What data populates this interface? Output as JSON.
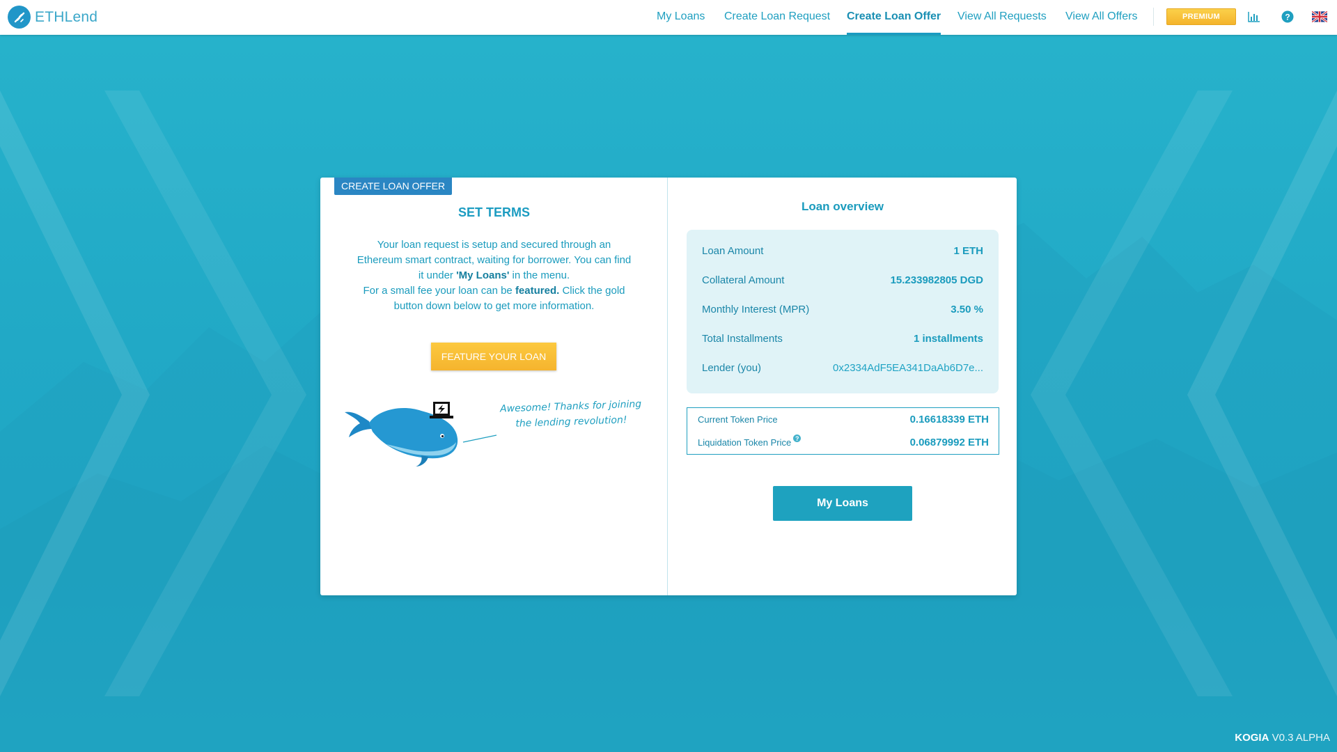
{
  "brand": {
    "name": "ETHLend"
  },
  "nav": {
    "items": [
      {
        "label": "My Loans"
      },
      {
        "label": "Create Loan Request"
      },
      {
        "label": "Create Loan Offer"
      },
      {
        "label": "View All Requests"
      },
      {
        "label": "View All Offers"
      }
    ],
    "active": "Create Loan Offer",
    "premium_label": "PREMIUM"
  },
  "icons": [
    "logo-icon",
    "stats-icon",
    "help-icon",
    "uk-flag-icon",
    "whale-illustration"
  ],
  "left": {
    "tag": "CREATE LOAN OFFER",
    "heading": "SET TERMS",
    "para1_a": "Your loan request is setup and secured through an Ethereum smart contract, waiting for borrower. You can find it under ",
    "para1_b": "'My Loans'",
    "para1_c": " in the menu.",
    "para2_a": "For a small fee your loan can be ",
    "para2_b": "featured.",
    "para2_c": " Click the gold button down below to get more information.",
    "feature_button": "FEATURE YOUR LOAN",
    "speech": "Awesome! Thanks for joining the lending revolution!"
  },
  "right": {
    "title": "Loan overview",
    "overview": [
      {
        "label": "Loan Amount",
        "value": "1 ETH"
      },
      {
        "label": "Collateral Amount",
        "value": "15.233982805 DGD"
      },
      {
        "label": "Monthly Interest (MPR)",
        "value": "3.50 %"
      },
      {
        "label": "Total Installments",
        "value": "1 installments"
      },
      {
        "label": "Lender (you)",
        "value": "0x2334AdF5EA341DaAb6D7e..."
      }
    ],
    "token": {
      "current_label": "Current Token Price",
      "current_value": "0.16618339 ETH",
      "liquidation_label": "Liquidation Token Price",
      "liquidation_help": "?",
      "liquidation_value": "0.06879992 ETH"
    },
    "my_loans_button": "My Loans"
  },
  "footer": {
    "brand": "KOGIA",
    "version": "V0.3 ALPHA"
  },
  "colors": {
    "accent": "#1ea2bf",
    "gold": "#f5b42e",
    "background": "#23adc9",
    "tag": "#2a86c3"
  }
}
